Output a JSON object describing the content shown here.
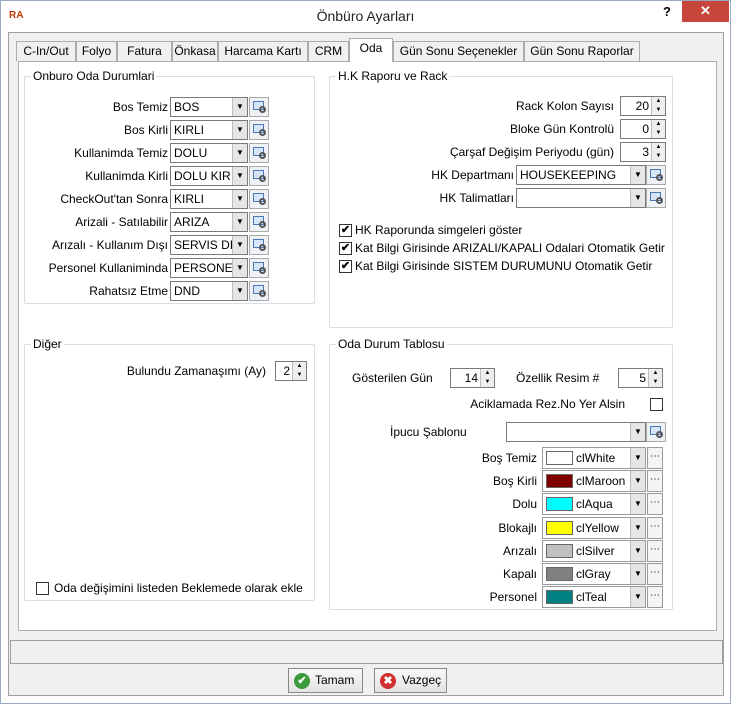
{
  "window": {
    "title": "Önbüro Ayarları",
    "help": "?",
    "close": "✕",
    "logo": "RA"
  },
  "tabs": [
    "C-In/Out",
    "Folyo",
    "Fatura",
    "Önkasa",
    "Harcama Kartı",
    "CRM",
    "Oda",
    "Gün Sonu Seçenekler",
    "Gün Sonu Raporlar"
  ],
  "active_tab": "Oda",
  "onburo": {
    "title": "Onburo Oda Durumlari",
    "rows": [
      {
        "label": "Bos Temiz",
        "value": "BOS"
      },
      {
        "label": "Bos Kirli",
        "value": "KIRLI"
      },
      {
        "label": "Kullanimda Temiz",
        "value": "DOLU"
      },
      {
        "label": "Kullanimda Kirli",
        "value": "DOLU KIR"
      },
      {
        "label": "CheckOut'tan Sonra",
        "value": "KIRLI"
      },
      {
        "label": "Arizali - Satılabilir",
        "value": "ARIZA"
      },
      {
        "label": "Arızalı - Kullanım Dışı",
        "value": "SERVIS DI"
      },
      {
        "label": "Personel Kullaniminda",
        "value": "PERSONE"
      },
      {
        "label": "Rahatsız Etme",
        "value": "DND"
      }
    ]
  },
  "hk": {
    "title": "H.K Raporu ve Rack",
    "rack_label": "Rack Kolon Sayısı",
    "rack_value": "20",
    "blok_label": "Bloke Gün Kontrolü",
    "blok_value": "0",
    "carsaf_label": "Çarşaf Değişim Periyodu (gün)",
    "carsaf_value": "3",
    "dept_label": "HK Departmanı",
    "dept_value": "HOUSEKEEPING",
    "talimat_label": "HK Talimatları",
    "talimat_value": "",
    "checks": [
      {
        "label": "HK Raporunda simgeleri göster",
        "checked": "✔"
      },
      {
        "label": "Kat Bilgi Girisinde ARIZALI/KAPALI Odalari Otomatik Getir",
        "checked": "✔"
      },
      {
        "label": "Kat Bilgi Girisinde SISTEM DURUMUNU Otomatik Getir",
        "checked": "✔"
      }
    ]
  },
  "diger": {
    "title": "Diğer",
    "zaman_label": "Bulundu Zamanaşımı (Ay)",
    "zaman_value": "2",
    "check_label": "Oda değişimini listeden Beklemede olarak ekle"
  },
  "oda": {
    "title": "Oda Durum Tablosu",
    "gun_label": "Gösterilen Gün",
    "gun_value": "14",
    "resim_label": "Özellik Resim #",
    "resim_value": "5",
    "aciklama_label": "Aciklamada Rez.No Yer Alsin",
    "ipucu_label": "İpucu Şablonu",
    "ipucu_value": "",
    "colors": [
      {
        "label": "Boş Temiz",
        "name": "clWhite",
        "hex": "#ffffff"
      },
      {
        "label": "Boş Kirli",
        "name": "clMaroon",
        "hex": "#800000"
      },
      {
        "label": "Dolu",
        "name": "clAqua",
        "hex": "#00ffff"
      },
      {
        "label": "Blokajlı",
        "name": "clYellow",
        "hex": "#ffff00"
      },
      {
        "label": "Arızalı",
        "name": "clSilver",
        "hex": "#c0c0c0"
      },
      {
        "label": "Kapalı",
        "name": "clGray",
        "hex": "#808080"
      },
      {
        "label": "Personel",
        "name": "clTeal",
        "hex": "#008080"
      }
    ]
  },
  "buttons": {
    "ok": "Tamam",
    "cancel": "Vazgeç"
  }
}
